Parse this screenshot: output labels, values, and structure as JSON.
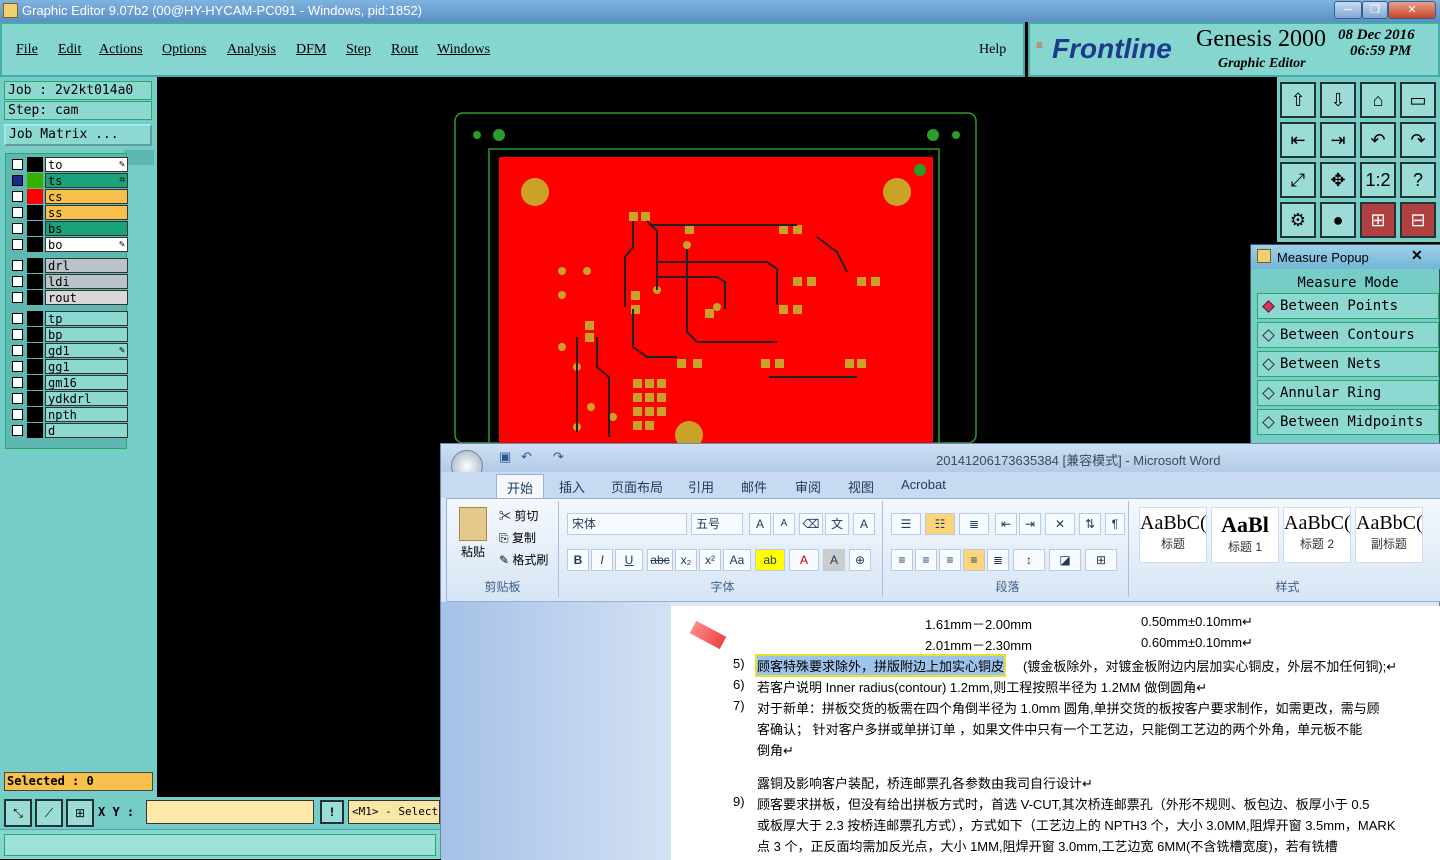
{
  "titlebar": {
    "title": "Graphic Editor 9.07b2 (00@HY-HYCAM-PC091 - Windows, pid:1852)",
    "min": "─",
    "max": "❐",
    "close": "✕"
  },
  "menu": [
    "File",
    "Edit",
    "Actions",
    "Options",
    "Analysis",
    "DFM",
    "Step",
    "Rout",
    "Windows"
  ],
  "help": "Help",
  "brand": {
    "logo": "Frontline",
    "product": "Genesis 2000",
    "subtitle": "Graphic Editor",
    "date": "08 Dec 2016",
    "time": "06:59 PM"
  },
  "job": {
    "job": "Job : 2v2kt014a0",
    "step": "Step: cam",
    "matrix": "Job Matrix ..."
  },
  "layers": [
    {
      "name": "to",
      "bg": "#ffffff",
      "swatch": "#000000",
      "mark": "✎"
    },
    {
      "name": "ts",
      "bg": "#1aa37a",
      "swatch": "#38b000",
      "mark": "⌗"
    },
    {
      "name": "cs",
      "bg": "#f7c04c",
      "swatch": "#ff0000",
      "mark": ""
    },
    {
      "name": "ss",
      "bg": "#f7c04c",
      "swatch": "#000000",
      "mark": ""
    },
    {
      "name": "bs",
      "bg": "#1aa37a",
      "swatch": "#000000",
      "mark": ""
    },
    {
      "name": "bo",
      "bg": "#ffffff",
      "swatch": "#000000",
      "mark": "✎"
    },
    {
      "name": "drl",
      "bg": "#b8c4c8",
      "swatch": "#000000",
      "mark": ""
    },
    {
      "name": "ldi",
      "bg": "#b8c4c8",
      "swatch": "#000000",
      "mark": ""
    },
    {
      "name": "rout",
      "bg": "#d8d8d8",
      "swatch": "#000000",
      "mark": ""
    },
    {
      "name": "tp",
      "bg": "#8ed8d2",
      "swatch": "#000000",
      "mark": ""
    },
    {
      "name": "bp",
      "bg": "#8ed8d2",
      "swatch": "#000000",
      "mark": ""
    },
    {
      "name": "gd1",
      "bg": "#8ed8d2",
      "swatch": "#000000",
      "mark": "✎"
    },
    {
      "name": "gg1",
      "bg": "#8ed8d2",
      "swatch": "#000000",
      "mark": ""
    },
    {
      "name": "gm16",
      "bg": "#8ed8d2",
      "swatch": "#000000",
      "mark": ""
    },
    {
      "name": "ydkdrl",
      "bg": "#8ed8d2",
      "swatch": "#000000",
      "mark": ""
    },
    {
      "name": "npth",
      "bg": "#8ed8d2",
      "swatch": "#000000",
      "mark": ""
    },
    {
      "name": "d",
      "bg": "#8ed8d2",
      "swatch": "#000000",
      "mark": ""
    }
  ],
  "selected": "Selected : 0",
  "coords": {
    "label": "X Y :",
    "value": "",
    "mode": "<M1> - Select"
  },
  "tools": [
    "⇧",
    "⇩",
    "⌂",
    "▭",
    "⇤",
    "⇥",
    "↶",
    "↷",
    "⤢",
    "✥",
    "1:2",
    "?",
    "⚙",
    "●",
    "⊞",
    "⊟"
  ],
  "measure": {
    "title": "Measure Popup",
    "mode": "Measure Mode",
    "items": [
      "Between Points",
      "Between Contours",
      "Between Nets",
      "Annular Ring",
      "Between Midpoints"
    ]
  },
  "word": {
    "title": "20141206173635384 [兼容模式] - Microsoft Word",
    "tabs": [
      "开始",
      "插入",
      "页面布局",
      "引用",
      "邮件",
      "审阅",
      "视图",
      "Acrobat"
    ],
    "clipboard": {
      "paste": "粘贴",
      "cut": "剪切",
      "copy": "复制",
      "format": "格式刷",
      "label": "剪贴板"
    },
    "font": {
      "name": "宋体",
      "size": "五号",
      "label": "字体"
    },
    "paragraph_label": "段落",
    "styles_label": "样式",
    "styles": [
      {
        "sample": "AaBbC(",
        "name": "标题"
      },
      {
        "sample": "AaBl",
        "name": "标题 1"
      },
      {
        "sample": "AaBbC(",
        "name": "标题 2"
      },
      {
        "sample": "AaBbC(",
        "name": "副标题"
      }
    ],
    "doc_lines": [
      {
        "num": "",
        "text": "1.61mm－2.00mm",
        "right": "0.50mm±0.10mm↵"
      },
      {
        "num": "",
        "text": "2.01mm－2.30mm",
        "right": "0.60mm±0.10mm↵"
      },
      {
        "num": "5)",
        "text": "顾客特殊要求除外，拼版附边上加实心铜皮",
        "right": "(镀金板除外，对镀金板附边内层加实心铜皮，外层不加任何铜);↵"
      },
      {
        "num": "6)",
        "text": "若客户说明 Inner radius(contour) 1.2mm,则工程按照半径为 1.2MM 做倒圆角↵",
        "right": ""
      },
      {
        "num": "7)",
        "text": "对于新单：拼板交货的板需在四个角倒半径为 1.0mm 圆角,单拼交货的板按客户要求制作，如需更改，需与顾",
        "right": ""
      },
      {
        "num": "",
        "text": "客确认； 针对客户多拼或单拼订单 ，如果文件中只有一个工艺边，只能倒工艺边的两个外角，单元板不能",
        "right": ""
      },
      {
        "num": "",
        "text": "倒角↵",
        "right": ""
      },
      {
        "num": "",
        "text": "露铜及影响客户装配，桥连邮票孔各参数由我司自行设计↵",
        "right": ""
      },
      {
        "num": "9)",
        "text": "顾客要求拼板，但没有给出拼板方式时，首选 V-CUT,其次桥连邮票孔（外形不规则、板包边、板厚小于 0.5",
        "right": ""
      },
      {
        "num": "",
        "text": "或板厚大于 2.3 按桥连邮票孔方式），方式如下（工艺边上的 NPTH3 个，大小 3.0MM,阻焊开窗 3.5mm，MARK",
        "right": ""
      },
      {
        "num": "",
        "text": "点 3 个，正反面均需加反光点，大小 1MM,阻焊开窗 3.0mm,工艺边宽 6MM(不含铣槽宽度)，若有铣槽",
        "right": ""
      }
    ]
  },
  "colors": {
    "teal": "#76cdc7",
    "copper": "#ff0000",
    "pad": "#c9a227",
    "outline": "#2a9d2a"
  }
}
